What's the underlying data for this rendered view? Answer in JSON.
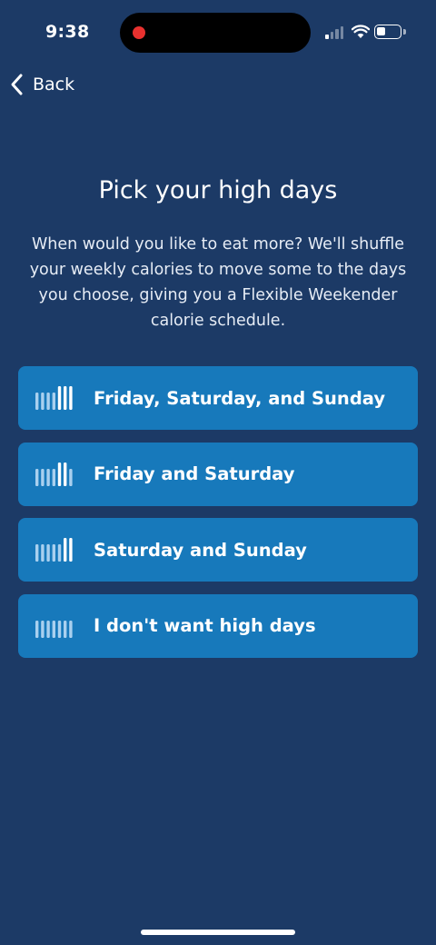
{
  "status_bar": {
    "time": "9:38"
  },
  "nav": {
    "back_label": "Back"
  },
  "header": {
    "title": "Pick your high days",
    "subtitle": "When would you like to eat more? We'll shuffle your weekly calories to move some to the days you choose, giving you a Flexible Weekender calorie schedule."
  },
  "options": [
    {
      "label": "Friday, Saturday, and Sunday",
      "icon": "week-bars-icon",
      "high_days": [
        5,
        6,
        7
      ]
    },
    {
      "label": "Friday and Saturday",
      "icon": "week-bars-icon",
      "high_days": [
        5,
        6
      ]
    },
    {
      "label": "Saturday and Sunday",
      "icon": "week-bars-icon",
      "high_days": [
        6,
        7
      ]
    },
    {
      "label": "I don't want high days",
      "icon": "week-bars-icon",
      "high_days": []
    }
  ],
  "colors": {
    "background": "#1c3a66",
    "option_background": "#1779bb",
    "bar_low": "#a9d0ef",
    "bar_high": "#ffffff",
    "record_dot": "#e8312f"
  }
}
